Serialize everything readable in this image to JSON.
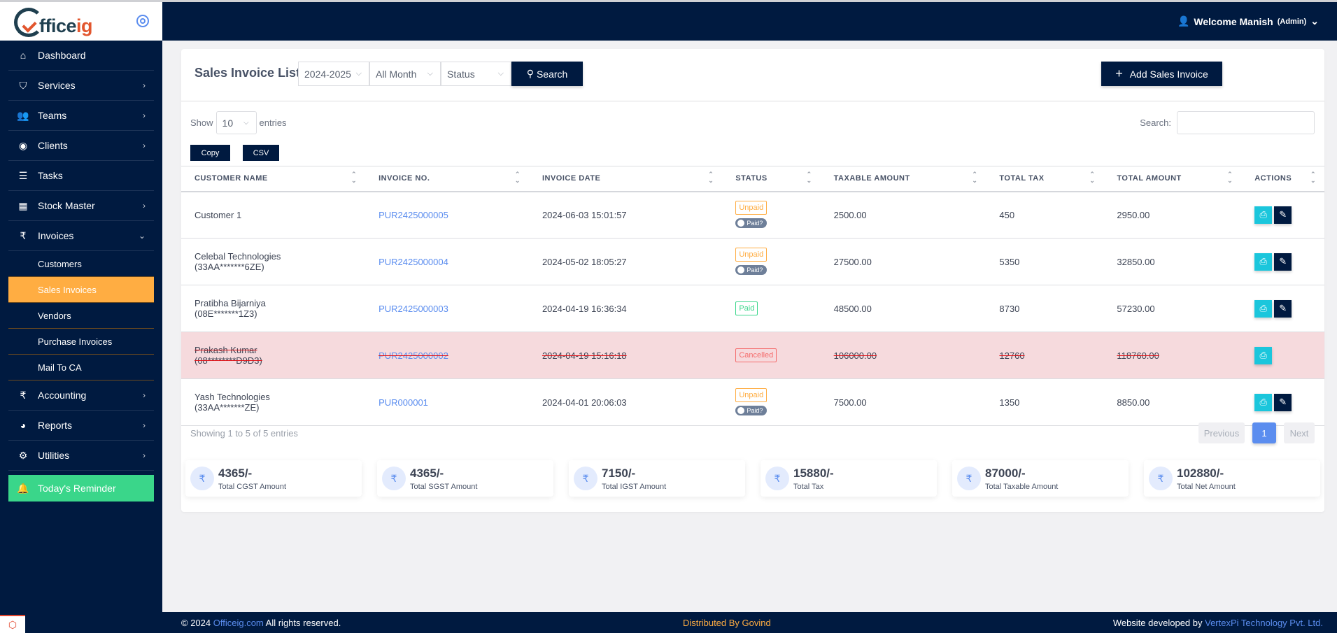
{
  "brand": {
    "logo_part1": "fficeig",
    "logo_part2": ""
  },
  "sidebar": {
    "items": [
      {
        "label": "Dashboard",
        "icon": "home-icon",
        "glyph": "⌂",
        "has_chevron": false
      },
      {
        "label": "Services",
        "icon": "shield-icon",
        "glyph": "⛉",
        "has_chevron": true
      },
      {
        "label": "Teams",
        "icon": "users-icon",
        "glyph": "👥",
        "has_chevron": true
      },
      {
        "label": "Clients",
        "icon": "user-circle-icon",
        "glyph": "◉",
        "has_chevron": true
      },
      {
        "label": "Tasks",
        "icon": "task-list-icon",
        "glyph": "☰",
        "has_chevron": false
      },
      {
        "label": "Stock Master",
        "icon": "store-icon",
        "glyph": "▦",
        "has_chevron": true
      },
      {
        "label": "Invoices",
        "icon": "rupee-icon",
        "glyph": "₹",
        "has_chevron": true,
        "expanded": true
      }
    ],
    "sub_items": [
      {
        "label": "Customers",
        "active": false
      },
      {
        "label": "Sales Invoices",
        "active": true
      },
      {
        "label": "Vendors",
        "active": false
      },
      {
        "label": "Purchase Invoices",
        "active": false
      },
      {
        "label": "Mail To CA",
        "active": false
      }
    ],
    "items_after": [
      {
        "label": "Accounting",
        "icon": "rupee-icon",
        "glyph": "₹",
        "has_chevron": true
      },
      {
        "label": "Reports",
        "icon": "pie-chart-icon",
        "glyph": "◕",
        "has_chevron": true
      },
      {
        "label": "Utilities",
        "icon": "gears-icon",
        "glyph": "⚙",
        "has_chevron": true
      }
    ],
    "reminder": {
      "label": "Today's Reminder",
      "icon": "bell-icon",
      "glyph": "🔔"
    }
  },
  "topbar": {
    "welcome": "Welcome Manish",
    "role": "(Admin)"
  },
  "page": {
    "title": "Sales Invoice List",
    "filters": {
      "year": "2024-2025",
      "month": "All Month",
      "status": "Status"
    },
    "search_button": "Search",
    "add_button": "Add Sales Invoice",
    "show_label": "Show",
    "entries_label": "entries",
    "page_length": "10",
    "search_label": "Search:",
    "search_value": "",
    "export_buttons": [
      "Copy",
      "CSV"
    ]
  },
  "table": {
    "columns": [
      "CUSTOMER NAME",
      "INVOICE NO.",
      "INVOICE DATE",
      "STATUS",
      "TAXABLE AMOUNT",
      "TOTAL TAX",
      "TOTAL AMOUNT",
      "ACTIONS"
    ],
    "rows": [
      {
        "customer": "Customer 1",
        "gst": "",
        "invoice_no": "PUR2425000005",
        "date": "2024-06-03 15:01:57",
        "status": "Unpaid",
        "paid_toggle": "Paid?",
        "taxable": "2500.00",
        "tax": "450",
        "total": "2950.00",
        "cancelled": false,
        "editable": true
      },
      {
        "customer": "Celebal Technologies",
        "gst": "(33AA*******6ZE)",
        "invoice_no": "PUR2425000004",
        "date": "2024-05-02 18:05:27",
        "status": "Unpaid",
        "paid_toggle": "Paid?",
        "taxable": "27500.00",
        "tax": "5350",
        "total": "32850.00",
        "cancelled": false,
        "editable": true
      },
      {
        "customer": "Pratibha Bijarniya",
        "gst": "(08E*******1Z3)",
        "invoice_no": "PUR2425000003",
        "date": "2024-04-19 16:36:34",
        "status": "Paid",
        "paid_toggle": "",
        "taxable": "48500.00",
        "tax": "8730",
        "total": "57230.00",
        "cancelled": false,
        "editable": true
      },
      {
        "customer": "Prakash Kumar",
        "gst": "(08********D9D3)",
        "invoice_no": "PUR2425000002",
        "date": "2024-04-19 15:16:18",
        "status": "Cancelled",
        "paid_toggle": "",
        "taxable": "106000.00",
        "tax": "12760",
        "total": "118760.00",
        "cancelled": true,
        "editable": false
      },
      {
        "customer": "Yash Technologies",
        "gst": "(33AA*******ZE)",
        "invoice_no": "PUR000001",
        "date": "2024-04-01 20:06:03",
        "status": "Unpaid",
        "paid_toggle": "Paid?",
        "taxable": "7500.00",
        "tax": "1350",
        "total": "8850.00",
        "cancelled": false,
        "editable": true
      }
    ]
  },
  "pagination": {
    "info": "Showing 1 to 5 of 5 entries",
    "previous": "Previous",
    "current": "1",
    "next": "Next"
  },
  "stats": [
    {
      "value": "4365/-",
      "label": "Total CGST Amount"
    },
    {
      "value": "4365/-",
      "label": "Total SGST Amount"
    },
    {
      "value": "7150/-",
      "label": "Total IGST Amount"
    },
    {
      "value": "15880/-",
      "label": "Total Tax"
    },
    {
      "value": "87000/-",
      "label": "Total Taxable Amount"
    },
    {
      "value": "102880/-",
      "label": "Total Net Amount"
    }
  ],
  "footer": {
    "copyright_prefix": "© 2024",
    "site_link": "Officeig.com",
    "copyright_suffix": "All rights reserved.",
    "distributed": "Distributed By Govind",
    "developed_prefix": "Website developed by",
    "developer_link": "VertexPi Technology Pvt. Ltd."
  },
  "colors": {
    "navy": "#001a40",
    "accent_orange": "#ffad42",
    "link_blue": "#5b8def",
    "reminder_green": "#3ad68a",
    "print_cyan": "#1bc6dc",
    "cancel_row": "#f6dadd"
  }
}
